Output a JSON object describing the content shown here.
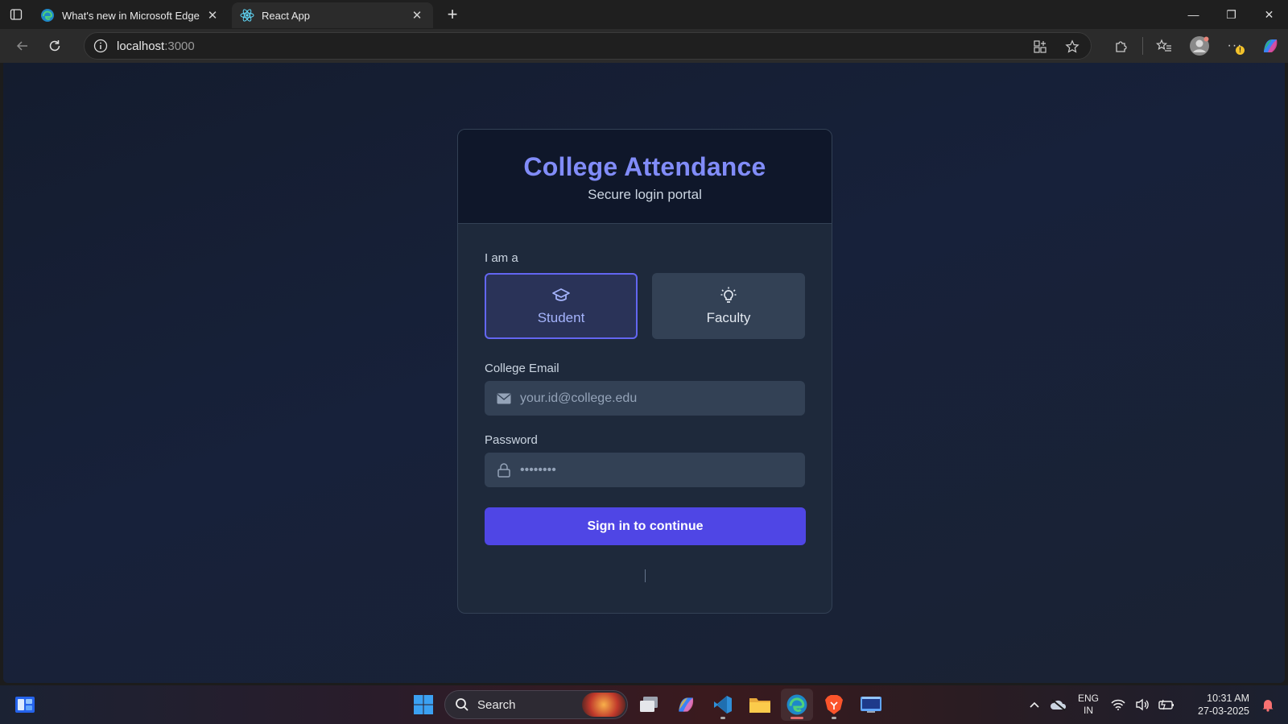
{
  "browser": {
    "tabs": [
      {
        "title": "What's new in Microsoft Edge",
        "active": false,
        "icon": "edge-icon"
      },
      {
        "title": "React App",
        "active": true,
        "icon": "react-icon"
      }
    ],
    "address": {
      "host": "localhost",
      "port": ":3000"
    }
  },
  "login": {
    "title": "College Attendance",
    "subtitle": "Secure login portal",
    "role_label": "I am a",
    "roles": {
      "student": "Student",
      "faculty": "Faculty"
    },
    "selected_role": "Student",
    "email": {
      "label": "College Email",
      "placeholder": "your.id@college.edu",
      "value": ""
    },
    "password": {
      "label": "Password",
      "placeholder": "••••••••",
      "value": ""
    },
    "submit_label": "Sign in to continue"
  },
  "taskbar": {
    "search_label": "Search",
    "lang_top": "ENG",
    "lang_bottom": "IN",
    "time": "10:31 AM",
    "date": "27-03-2025"
  },
  "colors": {
    "accent": "#4f46e5",
    "title": "#818cf8",
    "card_bg": "#1e293b",
    "page_bg": "#151d30"
  }
}
